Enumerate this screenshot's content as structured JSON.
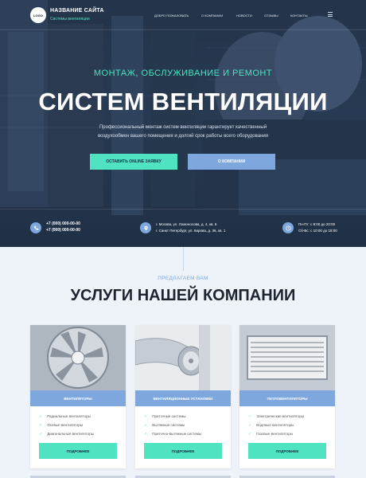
{
  "header": {
    "logo_text": "LOGO",
    "site_title": "НАЗВАНИЕ САЙТА",
    "site_subtitle": "Системы вентиляции",
    "nav": [
      "ДОБРО ПОЖАЛОВАТЬ",
      "О КОМПАНИИ",
      "НОВОСТИ",
      "ОТЗЫВЫ",
      "КОНТАКТЫ"
    ],
    "menu_icon": "hamburger-icon"
  },
  "hero": {
    "pre_title": "МОНТАЖ, ОБСЛУЖИВАНИЕ И РЕМОНТ",
    "title": "СИСТЕМ ВЕНТИЛЯЦИИ",
    "description": "Профессиональный монтаж систем вентиляции гарантирует качественный воздухообмен вашего помещения и долгий срок работы всего оборудования",
    "btn_order": "ОСТАВИТЬ ONLINE ЗАЯВКУ",
    "btn_about": "О КОМПАНИИ"
  },
  "contacts": {
    "phones": [
      "+7 (000) 000-00-00",
      "+7 (000) 000-00-00"
    ],
    "addresses": [
      "г. Москва, ул. Ломоносова, д. 4, кв. 5",
      "г. Санкт Петербург, ул. Кирова, д. 36, кв. 1"
    ],
    "hours": [
      "Пн-Пт: с 8:00 до 20:00",
      "Сб-Вс: с 10:00 до 18:00"
    ]
  },
  "services": {
    "pre_title": "ПРЕДЛАГАЕМ ВАМ",
    "title": "УСЛУГИ НАШЕЙ КОМПАНИИ",
    "more_label": "ПОДРОБНЕЕ",
    "cards": [
      {
        "title": "ВЕНТИЛЯТОРЫ",
        "items": [
          "Радиальные вентиляторы",
          "Осевые вентиляторы",
          "Диагональные вентиляторы"
        ]
      },
      {
        "title": "ВЕНТИЛЯЦИОННЫЕ УСТАНОВКИ",
        "items": [
          "Приточные системы",
          "Вытяжные системы",
          "Приточно-вытяжные системы"
        ]
      },
      {
        "title": "ТЕПЛОВЕНТИЛЯТОРЫ",
        "items": [
          "Электрические вентиляторы",
          "Водяные вентиляторы",
          "Газовые вентиляторы"
        ]
      }
    ]
  },
  "colors": {
    "accent": "#4fe3c1",
    "blue": "#7ea7de",
    "dark": "#1e2430"
  }
}
